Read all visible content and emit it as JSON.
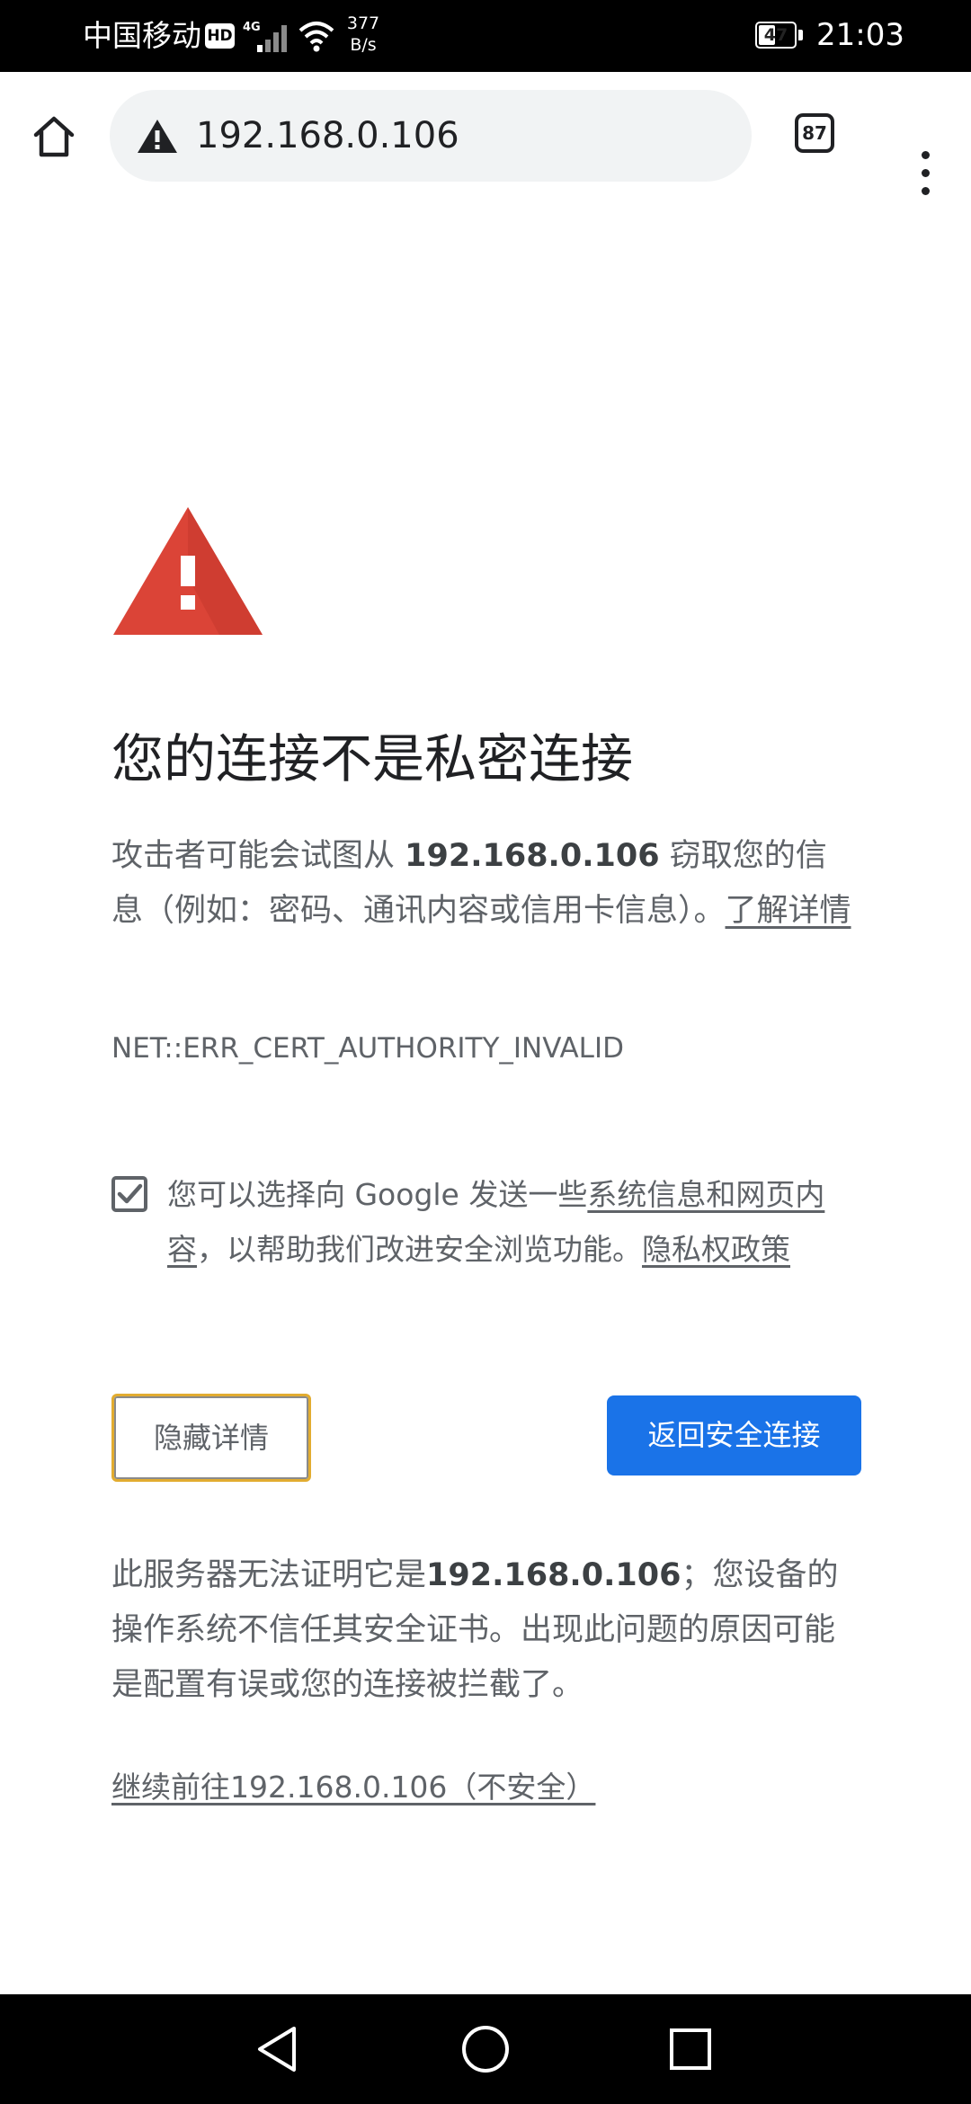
{
  "status_bar": {
    "carrier": "中国移动",
    "hd_badge": "HD",
    "network_type": "4G",
    "net_speed_value": "377",
    "net_speed_unit": "B/s",
    "battery_level": "47",
    "battery_fraction": 0.47,
    "time": "21:03"
  },
  "toolbar": {
    "url": "192.168.0.106",
    "tab_count": "87",
    "icons": {
      "home": "home-icon",
      "security": "warning-icon",
      "tabs": "tab-switcher-icon",
      "menu": "more-vert-icon"
    }
  },
  "interstitial": {
    "heading": "您的连接不是私密连接",
    "paragraph1": {
      "prefix": "攻击者可能会试图从 ",
      "host": "192.168.0.106",
      "suffix": " 窃取您的信息（例如：密码、通讯内容或信用卡信息）。",
      "learn_more": "了解详情"
    },
    "error_code": "NET::ERR_CERT_AUTHORITY_INVALID",
    "optin": {
      "checked": true,
      "prefix": "您可以选择向 Google 发送一些",
      "link1": "系统信息和网页内容",
      "middle": "，以帮助我们改进安全浏览功能。",
      "link2": "隐私权政策"
    },
    "buttons": {
      "details": "隐藏详情",
      "back": "返回安全连接"
    },
    "paragraph2": {
      "prefix": "此服务器无法证明它是",
      "host": "192.168.0.106",
      "suffix": "；您设备的操作系统不信任其安全证书。出现此问题的原因可能是配置有误或您的连接被拦截了。"
    },
    "proceed_link": "继续前往192.168.0.106（不安全）"
  },
  "nav_bar": {
    "icons": {
      "back": "back-triangle-icon",
      "home": "home-circle-icon",
      "recents": "recents-square-icon"
    }
  },
  "colors": {
    "accent_blue": "#1a73e8",
    "warning_red": "#db4437",
    "focus_ring": "#e2ac30",
    "text_secondary": "#5f6368"
  }
}
